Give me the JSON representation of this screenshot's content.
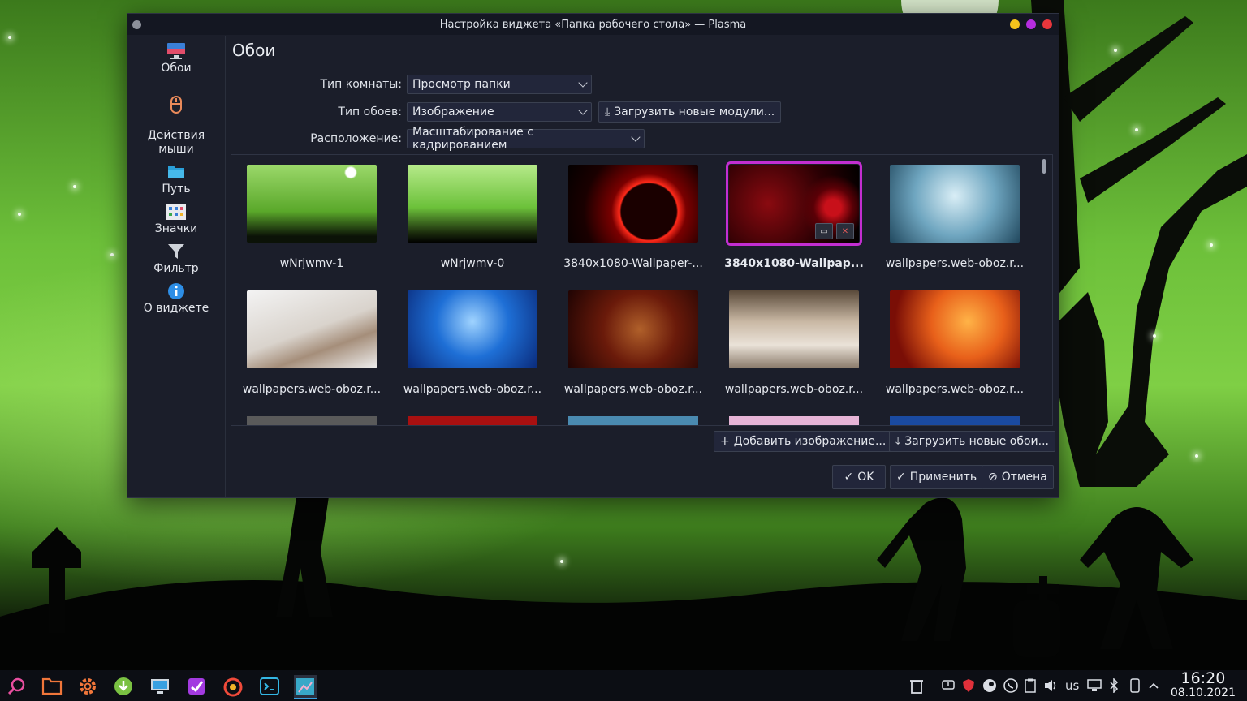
{
  "window": {
    "title": "Настройка виджета «Папка рабочего стола» — Plasma",
    "controls": [
      "#f4c21c",
      "#b62de0",
      "#e8363c"
    ]
  },
  "sidebar": {
    "items": [
      {
        "label": "Обои",
        "icon": "monitor-icon"
      },
      {
        "label": "Действия\nмыши",
        "icon": "mouse-icon"
      },
      {
        "label": "Путь",
        "icon": "folder-icon"
      },
      {
        "label": "Значки",
        "icon": "icons-grid-icon"
      },
      {
        "label": "Фильтр",
        "icon": "filter-icon"
      },
      {
        "label": "О виджете",
        "icon": "info-icon"
      }
    ]
  },
  "main": {
    "title": "Обои",
    "room_type": {
      "label": "Тип комнаты:",
      "value": "Просмотр папки"
    },
    "wallpaper_type": {
      "label": "Тип обоев:",
      "value": "Изображение"
    },
    "download_modules": "Загрузить новые модули...",
    "positioning": {
      "label": "Расположение:",
      "value": "Масштабирование с кадрированием"
    },
    "thumbnails": [
      {
        "caption": "wNrjwmv-1",
        "bg": "green-graveyard"
      },
      {
        "caption": "wNrjwmv-0",
        "bg": "green-field"
      },
      {
        "caption": "3840x1080-Wallpaper-...",
        "bg": "red-eclipse"
      },
      {
        "caption": "3840x1080-Wallpap...",
        "bg": "red-asteroids",
        "selected": true
      },
      {
        "caption": "wallpapers.web-oboz.r...",
        "bg": "underwater"
      },
      {
        "caption": "wallpapers.web-oboz.r...",
        "bg": "white-lingerie"
      },
      {
        "caption": "wallpapers.web-oboz.r...",
        "bg": "blue-flower"
      },
      {
        "caption": "wallpapers.web-oboz.r...",
        "bg": "muscle-red"
      },
      {
        "caption": "wallpapers.web-oboz.r...",
        "bg": "bed-scene"
      },
      {
        "caption": "wallpapers.web-oboz.r...",
        "bg": "orange-seven"
      }
    ],
    "add_image": "Добавить изображение...",
    "download_wallpapers": "Загрузить новые обои...",
    "ok": "OK",
    "apply": "Применить",
    "cancel": "Отмена"
  },
  "taskbar": {
    "layout": "us",
    "time": "16:20",
    "date": "08.10.2021"
  }
}
